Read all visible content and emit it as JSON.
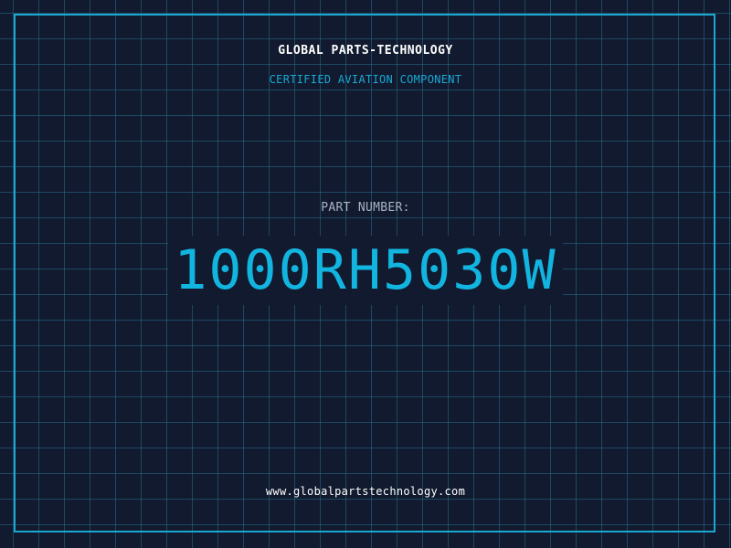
{
  "header": {
    "company": "GLOBAL PARTS-TECHNOLOGY",
    "subtitle": "CERTIFIED AVIATION COMPONENT"
  },
  "part": {
    "label": "PART NUMBER:",
    "number": "1000RH5030W"
  },
  "footer": {
    "website": "www.globalpartstechnology.com"
  },
  "colors": {
    "background": "#111a2e",
    "grid": "#266e8c",
    "accent": "#12b4e0",
    "frame": "#1aa8d0",
    "label": "#a9b4c2",
    "text": "#ffffff"
  }
}
